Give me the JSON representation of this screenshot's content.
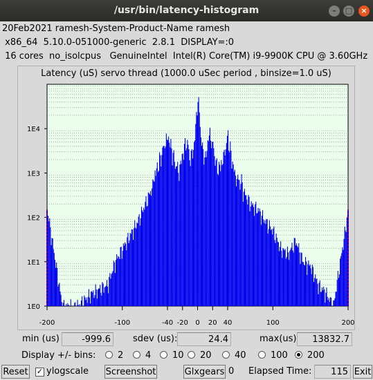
{
  "window": {
    "title": "/usr/bin/latency-histogram"
  },
  "info": {
    "line1": "20Feb2021 ramesh-System-Product-Name ramesh",
    "line2": " x86_64  5.10.0-051000-generic  2.8.1  DISPLAY=:0",
    "line3": " 16 cores  no_isolcpus   GenuineIntel  Intel(R) Core(TM) i9-9900K CPU @ 3.60GHz"
  },
  "chart_data": {
    "type": "bar",
    "title": "Latency (uS) servo thread (1000.0 uSec period , binsize=1.0 uS)",
    "xlim": [
      -200,
      200
    ],
    "ylim": [
      1,
      100000
    ],
    "yscale": "log",
    "x_ticks": [
      "-200",
      "-100",
      "-40",
      "-20",
      "0",
      "20",
      "40",
      "100",
      "200"
    ],
    "y_ticks": [
      "1E0",
      "1E1",
      "1E2",
      "1E3",
      "1E4"
    ],
    "series": [
      {
        "values": [
          [
            -200,
            150
          ],
          [
            -180,
            1
          ],
          [
            -160,
            1
          ],
          [
            -140,
            2
          ],
          [
            -120,
            3
          ],
          [
            -110,
            10
          ],
          [
            -100,
            20
          ],
          [
            -90,
            40
          ],
          [
            -80,
            80
          ],
          [
            -70,
            200
          ],
          [
            -60,
            500
          ],
          [
            -50,
            1500
          ],
          [
            -45,
            3000
          ],
          [
            -40,
            5000
          ],
          [
            -35,
            2500
          ],
          [
            -30,
            1200
          ],
          [
            -25,
            800
          ],
          [
            -20,
            2000
          ],
          [
            -15,
            4000
          ],
          [
            -10,
            1500
          ],
          [
            -5,
            3000
          ],
          [
            -3,
            8000
          ],
          [
            0,
            40000
          ],
          [
            3,
            10000
          ],
          [
            5,
            3000
          ],
          [
            10,
            1500
          ],
          [
            15,
            6000
          ],
          [
            20,
            3000
          ],
          [
            25,
            1000
          ],
          [
            30,
            1000
          ],
          [
            35,
            2000
          ],
          [
            40,
            5000
          ],
          [
            45,
            1500
          ],
          [
            50,
            600
          ],
          [
            60,
            400
          ],
          [
            70,
            200
          ],
          [
            80,
            150
          ],
          [
            90,
            80
          ],
          [
            100,
            50
          ],
          [
            110,
            20
          ],
          [
            120,
            15
          ],
          [
            130,
            30
          ],
          [
            140,
            10
          ],
          [
            150,
            8
          ],
          [
            160,
            3
          ],
          [
            170,
            2
          ],
          [
            180,
            1
          ],
          [
            200,
            150
          ]
        ]
      }
    ],
    "grid": "horizontal-dotted",
    "bar_color": "#0000ee",
    "edge_color": "#ff0000",
    "background": "#ecffec"
  },
  "stats": {
    "min_label": "min (us)",
    "min_value": "-999.6",
    "sdev_label": "sdev (us):",
    "sdev_value": "24.4",
    "max_label": "max(us)",
    "max_value": "13832.7"
  },
  "bins": {
    "label": "Display +/- bins:",
    "options": [
      "2",
      "4",
      "10",
      "20",
      "40",
      "100",
      "200"
    ],
    "selected": "200"
  },
  "controls": {
    "reset": "Reset",
    "ylogscale": "ylogscale",
    "ylogscale_checked": "✓",
    "screenshot": "Screenshot",
    "glxgears": "Glxgears",
    "glxgears_count": "0",
    "elapsed_label": "Elapsed Time:",
    "elapsed_value": "115",
    "exit": "Exit"
  }
}
